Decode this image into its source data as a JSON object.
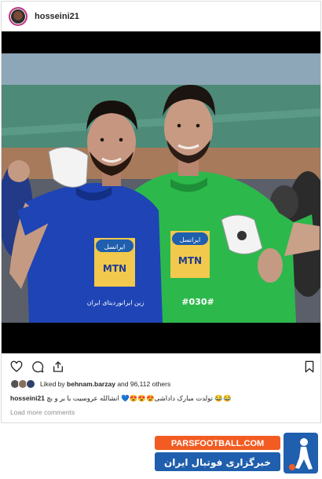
{
  "post": {
    "username": "hosseini21",
    "liked_by_prefix": "Liked by",
    "liked_by_user": "behnam.barzay",
    "liked_by_suffix": "and 96,112 others",
    "caption_user": "hosseini21",
    "caption_text": "😂😂 تولدت مبارک داداشی😍😍😍💙 انشالله عروسیت با بر و بچ",
    "load_more": "Load more comments"
  },
  "photo": {
    "left_player": {
      "sponsor_top": "ایرانسل",
      "sponsor_mtn": "MTN",
      "sponsor_bottom": "زین ایرانوردیتای ایران"
    },
    "right_player": {
      "sponsor_top": "ایرانسل",
      "sponsor_mtn": "MTN",
      "phone": "#030#"
    }
  },
  "watermark": {
    "domain": "PARSFOOTBALL.COM",
    "tagline": "خبرگزاری فوتبال ایران"
  },
  "icons": [
    "heart-icon",
    "comment-icon",
    "share-icon",
    "bookmark-icon"
  ],
  "colors": {
    "accent_orange": "#f25c22",
    "brand_blue": "#1f5fae",
    "shirt_blue": "#1e44b5",
    "shirt_green": "#2db84c"
  }
}
